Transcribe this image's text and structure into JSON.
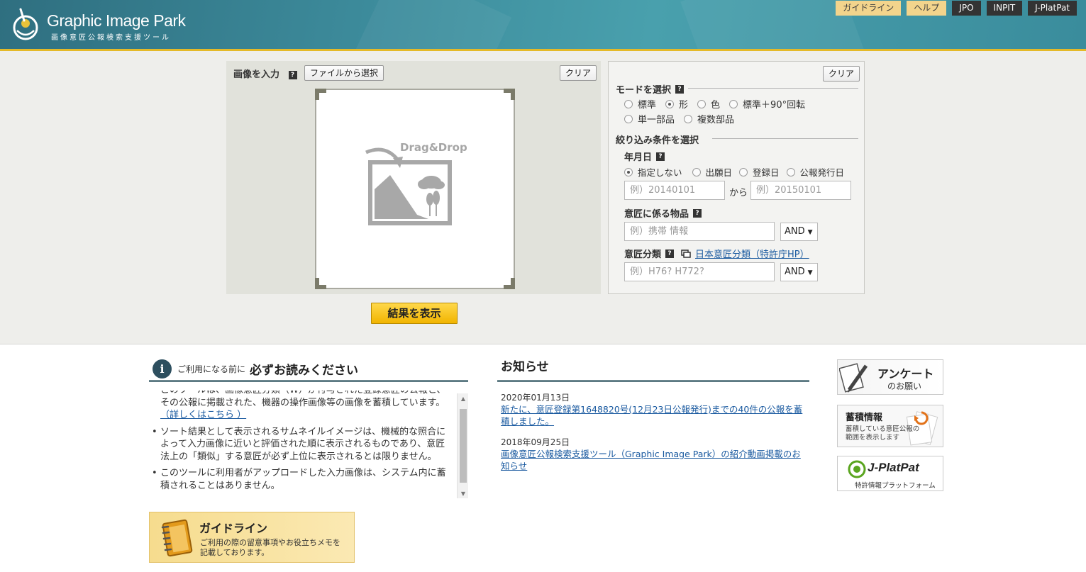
{
  "header": {
    "logo_title": "Graphic Image Park",
    "logo_subtitle": "画像意匠公報検索支援ツール",
    "nav": [
      {
        "label": "ガイドライン",
        "style": "yellow"
      },
      {
        "label": "ヘルプ",
        "style": "yellow"
      },
      {
        "label": "JPO",
        "style": "dark"
      },
      {
        "label": "INPIT",
        "style": "dark"
      },
      {
        "label": "J-PlatPat",
        "style": "dark"
      }
    ]
  },
  "image_input": {
    "label": "画像を入力",
    "help": "?",
    "select_file_button": "ファイルから選択",
    "clear_button": "クリア",
    "drop_text": "Drag&Drop"
  },
  "submit_button": "結果を表示",
  "options": {
    "clear_button": "クリア",
    "mode_title": "モードを選択",
    "modes": [
      {
        "label": "標準",
        "selected": false
      },
      {
        "label": "形",
        "selected": true
      },
      {
        "label": "色",
        "selected": false
      },
      {
        "label": "標準＋90°回転",
        "selected": false
      },
      {
        "label": "単一部品",
        "selected": false
      },
      {
        "label": "複数部品",
        "selected": false
      }
    ],
    "filter_title": "絞り込み条件を選択",
    "date_title": "年月日",
    "date_types": [
      {
        "label": "指定しない",
        "selected": true
      },
      {
        "label": "出願日",
        "selected": false
      },
      {
        "label": "登録日",
        "selected": false
      },
      {
        "label": "公報発行日",
        "selected": false
      }
    ],
    "date_from_placeholder": "例）20140101",
    "date_to_label": "から",
    "date_to_placeholder": "例）20150101",
    "article_title": "意匠に係る物品",
    "article_placeholder": "例）携帯 情報",
    "article_operator": "AND",
    "class_title": "意匠分類",
    "class_link": "日本意匠分類（特許庁HP）",
    "class_placeholder": "例）H76? H772?",
    "class_operator": "AND"
  },
  "notice": {
    "pre": "ご利用になる前に",
    "title": "必ずお読みください",
    "items": [
      "このツールは、画像意匠分類（W）が付与された登録意匠の公報と、その公報に掲載された、機器の操作画像等の画像を蓄積しています。",
      "ソート結果として表示されるサムネイルイメージは、機械的な照合によって入力画像に近いと評価された順に表示されるものであり、意匠法上の「類似」する意匠が必ず上位に表示されるとは限りません。",
      "このツールに利用者がアップロードした入力画像は、システム内に蓄積されることはありません。"
    ],
    "more_link": "（詳しくはこちら ）"
  },
  "guide_banner": {
    "title": "ガイドライン",
    "desc_line1": "ご利用の際の留意事項やお役立ちメモを",
    "desc_line2": "記載しております。"
  },
  "news": {
    "title": "お知らせ",
    "items": [
      {
        "date": "2020年01月13日",
        "text": "新たに、意匠登録第1648820号(12月23日公報発行)までの40件の公報を蓄積しました。"
      },
      {
        "date": "2018年09月25日",
        "text": "画像意匠公報検索支援ツール（Graphic Image Park）の紹介動画掲載のお知らせ"
      }
    ]
  },
  "side_banners": {
    "survey_title": "アンケート",
    "survey_sub": "のお願い",
    "stock_title": "蓄積情報",
    "stock_line1": "蓄積している意匠公報の",
    "stock_line2": "範囲を表示します",
    "jpp_title": "J-PlatPat",
    "jpp_sub": "特許情報プラットフォーム"
  },
  "colors": {
    "header": "#3d8c9c",
    "header_border": "#e4b928",
    "accent_dark": "#234a57",
    "link": "#1a5aa0",
    "submit": "#f5c21a"
  }
}
